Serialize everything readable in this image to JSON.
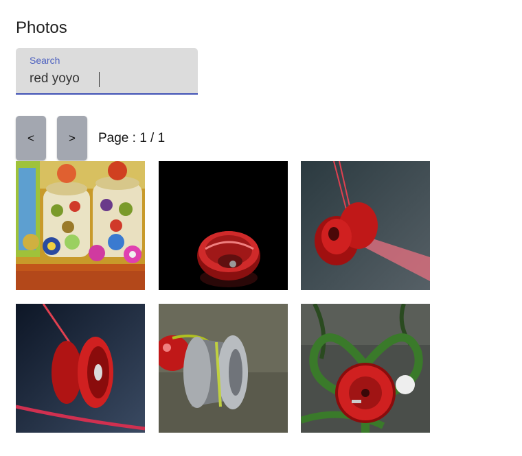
{
  "page": {
    "title": "Photos"
  },
  "search": {
    "label": "Search",
    "value": "red yoyo"
  },
  "pager": {
    "prev_label": "<",
    "next_label": ">",
    "page_text": "Page : 1 / 1"
  },
  "photos": [
    {
      "subject": "painted fruit cookie jars with colorful yoyos"
    },
    {
      "subject": "red yoyo on black background"
    },
    {
      "subject": "red yoyo spinning on string"
    },
    {
      "subject": "red yoyo with string close-up"
    },
    {
      "subject": "silver yoyo with red ball"
    },
    {
      "subject": "red yoyo in bamboo plant"
    }
  ],
  "colors": {
    "accent": "#3f51b5",
    "search_bg": "#dcdcdc",
    "button_bg": "#a3a7b0"
  }
}
